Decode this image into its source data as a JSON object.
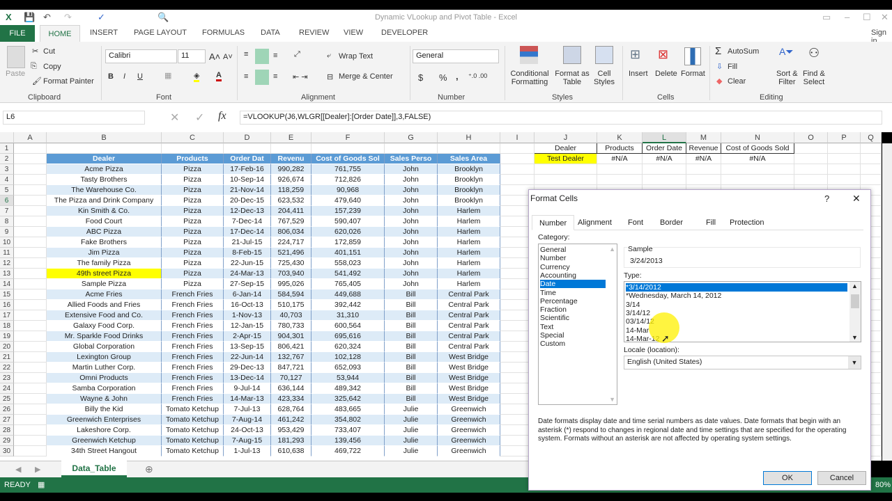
{
  "app": {
    "title": "Dynamic VLookup and Pivot Table - Excel",
    "sign_in": "Sign in"
  },
  "ribbon_tabs": [
    "FILE",
    "HOME",
    "INSERT",
    "PAGE LAYOUT",
    "FORMULAS",
    "DATA",
    "REVIEW",
    "VIEW",
    "DEVELOPER"
  ],
  "clipboard": {
    "paste": "Paste",
    "cut": "Cut",
    "copy": "Copy",
    "format_painter": "Format Painter",
    "label": "Clipboard"
  },
  "font": {
    "name": "Calibri",
    "size": "11",
    "label": "Font",
    "bold": "B",
    "italic": "I",
    "underline": "U"
  },
  "alignment": {
    "wrap": "Wrap Text",
    "merge": "Merge & Center",
    "label": "Alignment"
  },
  "number": {
    "format": "General",
    "currency": "$",
    "percent": "%",
    "comma": ",",
    "label": "Number"
  },
  "styles": {
    "conditional": "Conditional",
    "conditional2": "Formatting",
    "format_table": "Format as",
    "format_table2": "Table",
    "cell_styles": "Cell",
    "cell_styles2": "Styles",
    "label": "Styles"
  },
  "cells": {
    "insert": "Insert",
    "delete": "Delete",
    "format": "Format",
    "label": "Cells"
  },
  "editing": {
    "autosum": "AutoSum",
    "fill": "Fill",
    "clear": "Clear",
    "sort": "Sort &",
    "sort2": "Filter",
    "find": "Find &",
    "find2": "Select",
    "label": "Editing"
  },
  "formula_bar": {
    "name_box": "L6",
    "formula": "=VLOOKUP(J6,WLGR[[Dealer]:[Order Date]],3,FALSE)",
    "fx": "fx"
  },
  "columns": [
    "A",
    "B",
    "C",
    "D",
    "E",
    "F",
    "G",
    "H",
    "I",
    "J",
    "K",
    "L",
    "M",
    "N",
    "O",
    "P",
    "Q"
  ],
  "table": {
    "headers": [
      "Dealer",
      "Products",
      "Order Dat",
      "Revenu",
      "Cost of Goods Sol",
      "Sales Perso",
      "Sales Area"
    ],
    "rows": [
      [
        "Acme Pizza",
        "Pizza",
        "17-Feb-16",
        "990,282",
        "761,755",
        "John",
        "Brooklyn"
      ],
      [
        "Tasty Brothers",
        "Pizza",
        "10-Sep-14",
        "926,674",
        "712,826",
        "John",
        "Brooklyn"
      ],
      [
        "The Warehouse Co.",
        "Pizza",
        "21-Nov-14",
        "118,259",
        "90,968",
        "John",
        "Brooklyn"
      ],
      [
        "The Pizza and Drink Company",
        "Pizza",
        "20-Dec-15",
        "623,532",
        "479,640",
        "John",
        "Brooklyn"
      ],
      [
        "Kin Smith & Co.",
        "Pizza",
        "12-Dec-13",
        "204,411",
        "157,239",
        "John",
        "Harlem"
      ],
      [
        "Food Court",
        "Pizza",
        "7-Dec-14",
        "767,529",
        "590,407",
        "John",
        "Harlem"
      ],
      [
        "ABC Pizza",
        "Pizza",
        "17-Dec-14",
        "806,034",
        "620,026",
        "John",
        "Harlem"
      ],
      [
        "Fake Brothers",
        "Pizza",
        "21-Jul-15",
        "224,717",
        "172,859",
        "John",
        "Harlem"
      ],
      [
        "Jim Pizza",
        "Pizza",
        "8-Feb-15",
        "521,496",
        "401,151",
        "John",
        "Harlem"
      ],
      [
        "The family Pizza",
        "Pizza",
        "22-Jun-15",
        "725,430",
        "558,023",
        "John",
        "Harlem"
      ],
      [
        "49th street Pizza",
        "Pizza",
        "24-Mar-13",
        "703,940",
        "541,492",
        "John",
        "Harlem"
      ],
      [
        "Sample Pizza",
        "Pizza",
        "27-Sep-15",
        "995,026",
        "765,405",
        "John",
        "Harlem"
      ],
      [
        "Acme Fries",
        "French Fries",
        "6-Jan-14",
        "584,594",
        "449,688",
        "Bill",
        "Central Park"
      ],
      [
        "Allied Foods and Fries",
        "French Fries",
        "16-Oct-13",
        "510,175",
        "392,442",
        "Bill",
        "Central Park"
      ],
      [
        "Extensive Food and Co.",
        "French Fries",
        "1-Nov-13",
        "40,703",
        "31,310",
        "Bill",
        "Central Park"
      ],
      [
        "Galaxy Food Corp.",
        "French Fries",
        "12-Jan-15",
        "780,733",
        "600,564",
        "Bill",
        "Central Park"
      ],
      [
        "Mr. Sparkle Food Drinks",
        "French Fries",
        "2-Apr-15",
        "904,301",
        "695,616",
        "Bill",
        "Central Park"
      ],
      [
        "Global Corporation",
        "French Fries",
        "13-Sep-15",
        "806,421",
        "620,324",
        "Bill",
        "Central Park"
      ],
      [
        "Lexington Group",
        "French Fries",
        "22-Jun-14",
        "132,767",
        "102,128",
        "Bill",
        "West Bridge"
      ],
      [
        "Martin Luther Corp.",
        "French Fries",
        "29-Dec-13",
        "847,721",
        "652,093",
        "Bill",
        "West Bridge"
      ],
      [
        "Omni Products",
        "French Fries",
        "13-Dec-14",
        "70,127",
        "53,944",
        "Bill",
        "West Bridge"
      ],
      [
        "Samba Corporation",
        "French Fries",
        "9-Jul-14",
        "636,144",
        "489,342",
        "Bill",
        "West Bridge"
      ],
      [
        "Wayne & John",
        "French Fries",
        "14-Mar-13",
        "423,334",
        "325,642",
        "Bill",
        "West Bridge"
      ],
      [
        "Billy the Kid",
        "Tomato Ketchup",
        "7-Jul-13",
        "628,764",
        "483,665",
        "Julie",
        "Greenwich"
      ],
      [
        "Greenwich Enterprises",
        "Tomato Ketchup",
        "7-Aug-14",
        "461,242",
        "354,802",
        "Julie",
        "Greenwich"
      ],
      [
        "Lakeshore Corp.",
        "Tomato Ketchup",
        "24-Oct-13",
        "953,429",
        "733,407",
        "Julie",
        "Greenwich"
      ],
      [
        "Greenwich Ketchup",
        "Tomato Ketchup",
        "7-Aug-15",
        "181,293",
        "139,456",
        "Julie",
        "Greenwich"
      ],
      [
        "34th Street Hangout",
        "Tomato Ketchup",
        "1-Jul-13",
        "610,638",
        "469,722",
        "Julie",
        "Greenwich"
      ]
    ],
    "highlight_row_dealer": "49th street Pizza"
  },
  "lookup": {
    "headers": [
      "Dealer",
      "Products",
      "Order Date",
      "Revenue",
      "Cost of Goods Sold"
    ],
    "values": [
      "Test Dealer",
      "#N/A",
      "#N/A",
      "#N/A",
      "#N/A"
    ]
  },
  "sheet_tab": "Data_Table",
  "status": {
    "ready": "READY",
    "zoom": "80%"
  },
  "colors": {
    "excel_green": "#217346",
    "table_header": "#5b9bd5",
    "band": "#ddebf7",
    "highlight": "#ffff00",
    "selection": "#0078d7"
  },
  "dialog": {
    "title": "Format Cells",
    "help": "?",
    "close": "✕",
    "tabs": [
      "Number",
      "Alignment",
      "Font",
      "Border",
      "Fill",
      "Protection"
    ],
    "category_label": "Category:",
    "categories": [
      "General",
      "Number",
      "Currency",
      "Accounting",
      "Date",
      "Time",
      "Percentage",
      "Fraction",
      "Scientific",
      "Text",
      "Special",
      "Custom"
    ],
    "selected_category": "Date",
    "sample_label": "Sample",
    "sample_value": "3/24/2013",
    "type_label": "Type:",
    "types": [
      "*3/14/2012",
      "*Wednesday, March 14, 2012",
      "3/14",
      "3/14/12",
      "03/14/12",
      "14-Mar",
      "14-Mar-12"
    ],
    "selected_type": "*3/14/2012",
    "locale_label": "Locale (location):",
    "locale": "English (United States)",
    "description": "Date formats display date and time serial numbers as date values.  Date formats that begin with an asterisk (*) respond to changes in regional date and time settings that are specified for the operating system. Formats without an asterisk are not affected by operating system settings.",
    "ok": "OK",
    "cancel": "Cancel"
  }
}
